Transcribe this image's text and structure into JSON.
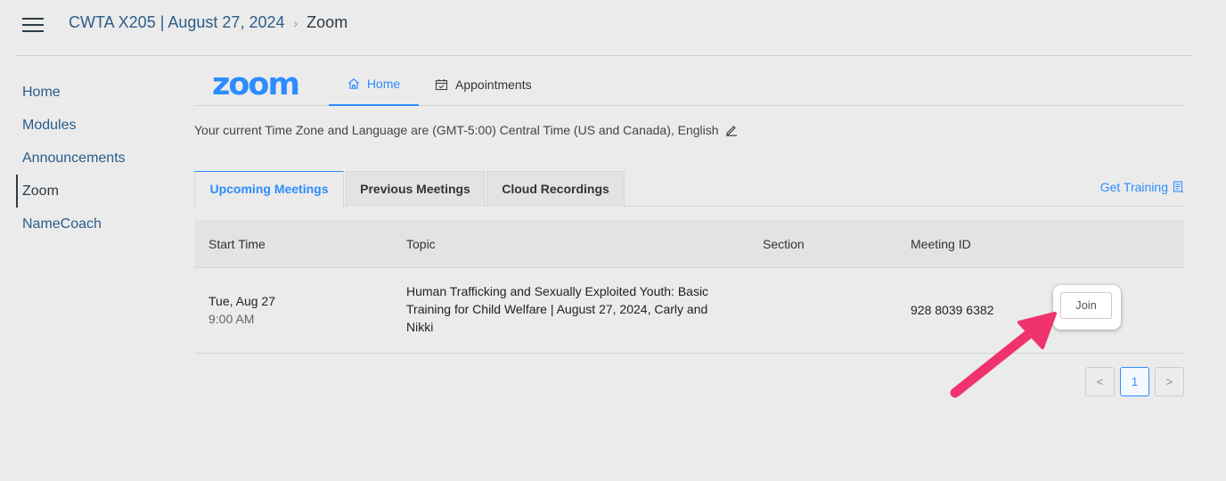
{
  "breadcrumb": {
    "course": "CWTA X205 | August 27, 2024",
    "separator": "›",
    "current": "Zoom"
  },
  "sidenav": {
    "items": [
      {
        "label": "Home",
        "active": false
      },
      {
        "label": "Modules",
        "active": false
      },
      {
        "label": "Announcements",
        "active": false
      },
      {
        "label": "Zoom",
        "active": true
      },
      {
        "label": "NameCoach",
        "active": false
      }
    ]
  },
  "zoom": {
    "logo": "zoom",
    "tabs": {
      "home": "Home",
      "appointments": "Appointments"
    },
    "timezone_text": "Your current Time Zone and Language are (GMT-5:00) Central Time (US and Canada), English",
    "meeting_tabs": {
      "upcoming": "Upcoming Meetings",
      "previous": "Previous Meetings",
      "cloud": "Cloud Recordings"
    },
    "get_training": "Get Training",
    "table": {
      "headers": {
        "start_time": "Start Time",
        "topic": "Topic",
        "section": "Section",
        "meeting_id": "Meeting ID"
      },
      "rows": [
        {
          "date": "Tue, Aug 27",
          "time": "9:00 AM",
          "topic": "Human Trafficking and Sexually Exploited Youth: Basic Training for Child Welfare | August 27, 2024, Carly and Nikki",
          "section": "",
          "meeting_id": "928 8039 6382",
          "action": "Join"
        }
      ]
    },
    "pagination": {
      "prev": "<",
      "current_page": "1",
      "next": ">"
    }
  },
  "colors": {
    "zoom_blue": "#2d8cff",
    "canvas_link": "#2b5c8a",
    "annotation_arrow": "#f0336e"
  }
}
